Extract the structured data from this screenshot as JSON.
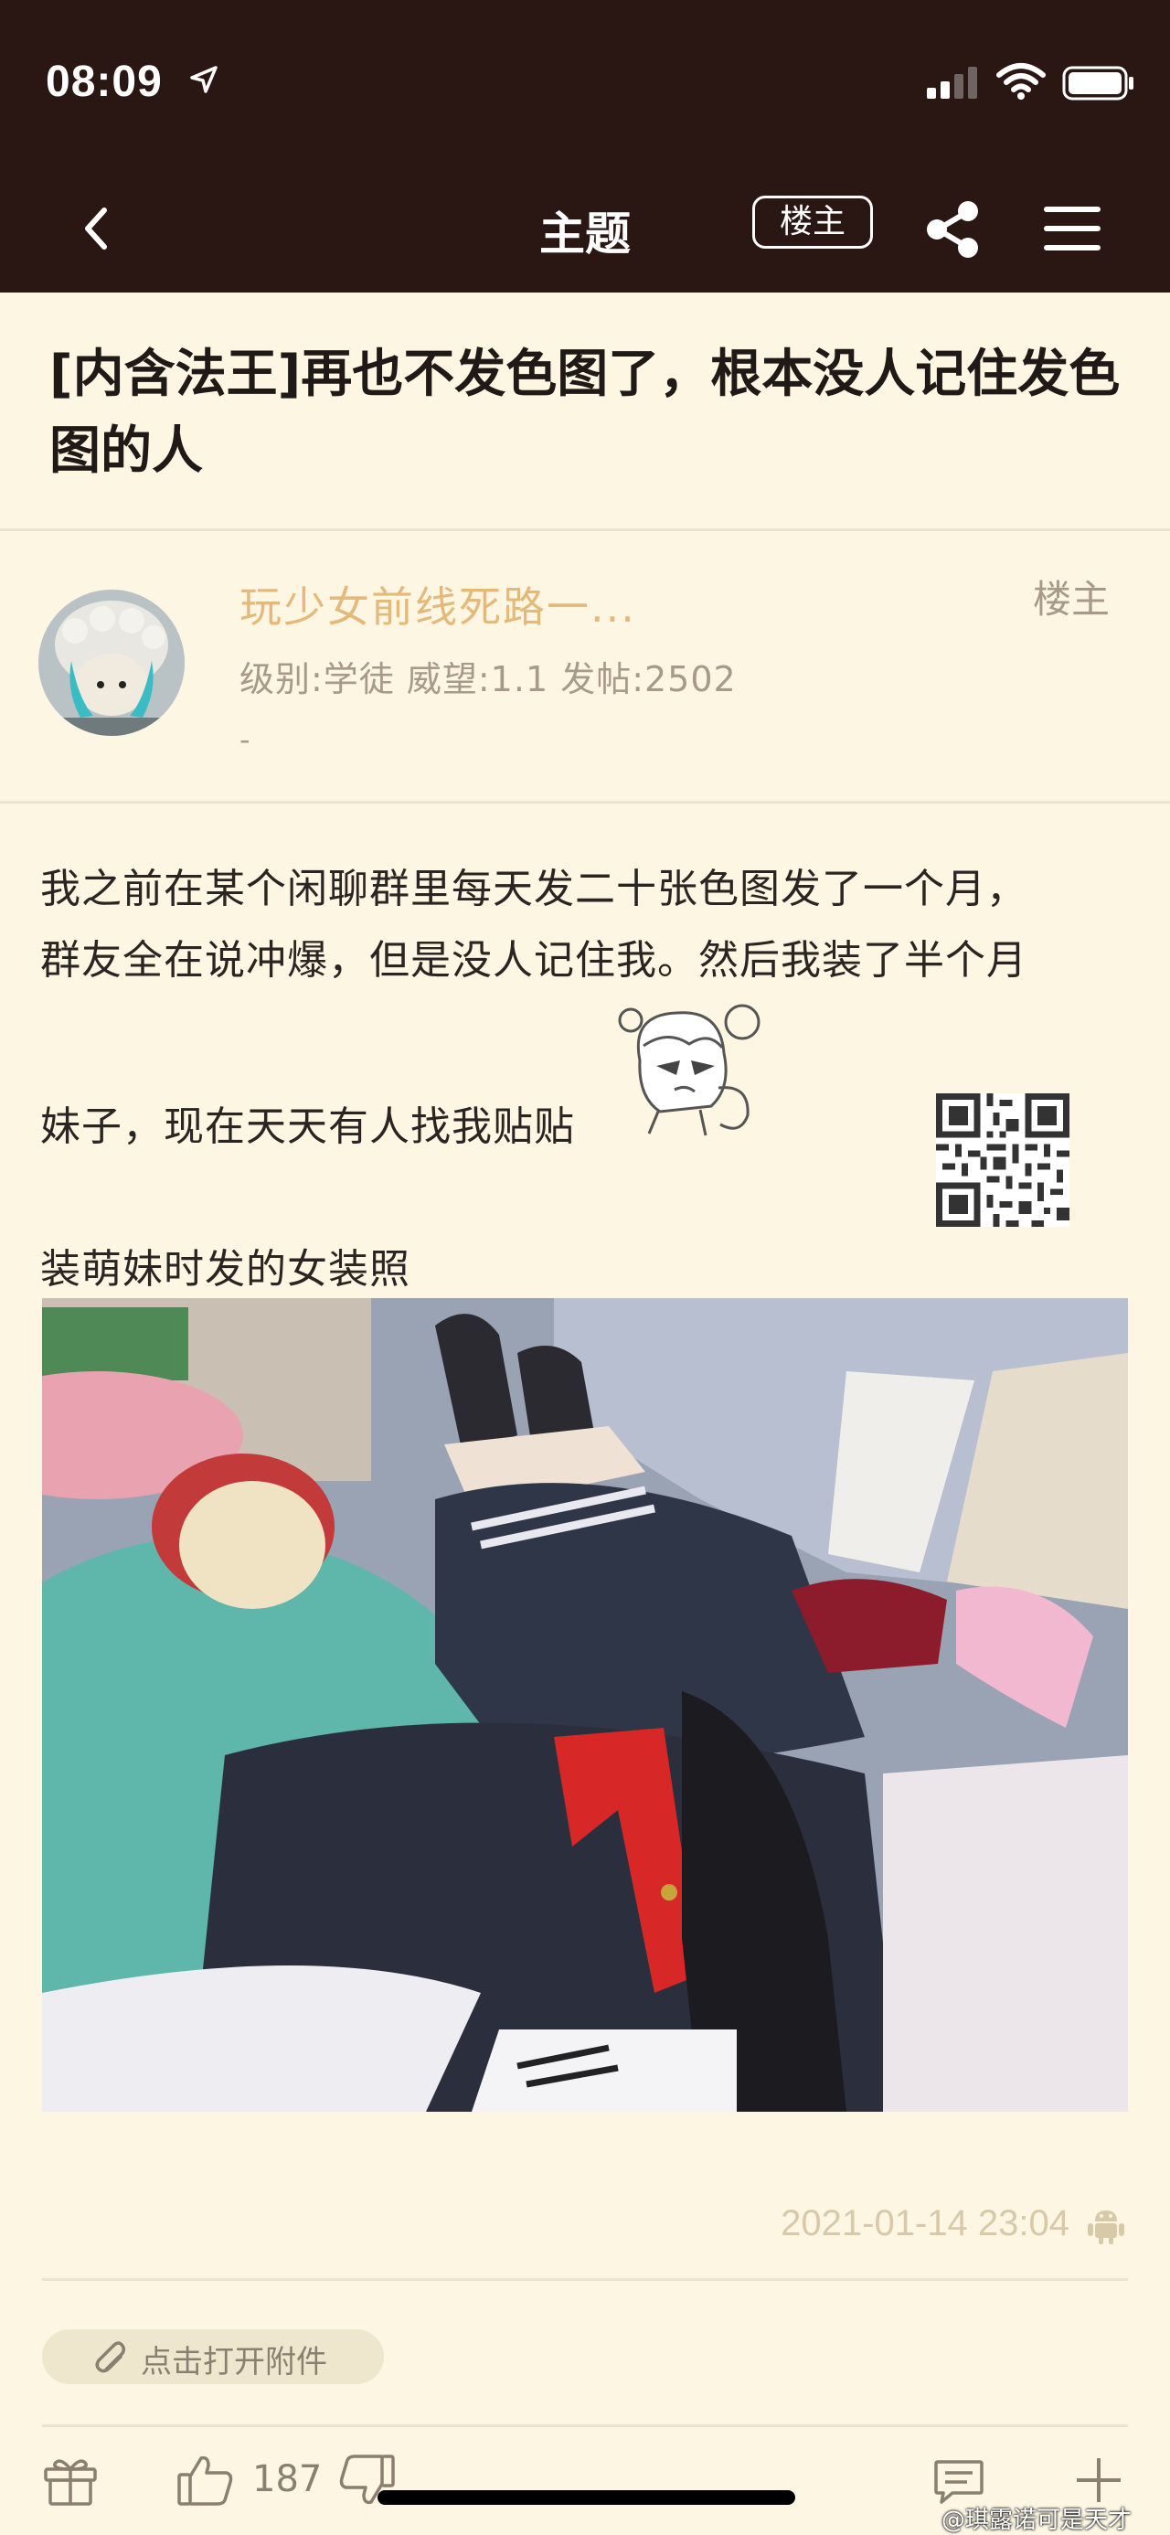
{
  "status_bar": {
    "time": "08:09",
    "location_icon": "location-arrow-icon",
    "signal_icon": "cellular-signal-icon",
    "wifi_icon": "wifi-icon",
    "battery_icon": "battery-icon"
  },
  "nav": {
    "title": "主题",
    "op_label": "楼主",
    "back_icon": "chevron-left-icon",
    "share_icon": "share-icon",
    "menu_icon": "hamburger-menu-icon"
  },
  "thread": {
    "title": "[内含法王]再也不发色图了，根本没人记住发色图的人"
  },
  "author": {
    "name": "玩少女前线死路一...",
    "tag": "楼主",
    "meta": "级别:学徒   威望:1.1   发帖:2502",
    "signature": "-"
  },
  "post": {
    "line1": "我之前在某个闲聊群里每天发二十张色图发了一个月，",
    "line2": "群友全在说冲爆，但是没人记住我。然后我装了半个月",
    "line3": "妹子，现在天天有人找我贴贴",
    "line4": "装萌妹时发的女装照",
    "timestamp": "2021-01-14 23:04",
    "attachment_label": "点击打开附件"
  },
  "actions": {
    "like_count": "187"
  },
  "watermark": "@琪露诺可是天才",
  "colors": {
    "header_bg": "#2a1713",
    "page_bg": "#fdf6e3",
    "author_name": "#e4b97a",
    "muted": "#a79a87"
  }
}
